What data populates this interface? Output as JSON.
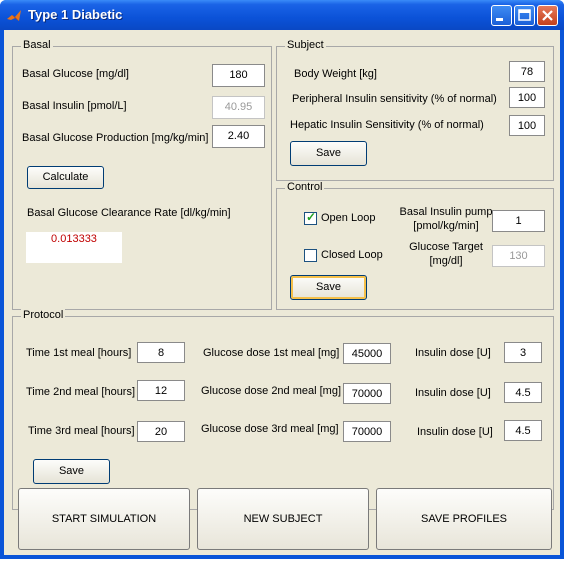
{
  "window": {
    "title": "Type 1 Diabetic"
  },
  "basal": {
    "title": "Basal",
    "glucose_label": "Basal Glucose [mg/dl]",
    "glucose_value": "180",
    "insulin_label": "Basal Insulin [pmol/L]",
    "insulin_value": "40.95",
    "production_label": "Basal Glucose Production [mg/kg/min]",
    "production_value": "2.40",
    "calculate_label": "Calculate",
    "clearance_label": "Basal Glucose Clearance Rate [dl/kg/min]",
    "clearance_value": "0.013333"
  },
  "subject": {
    "title": "Subject",
    "weight_label": "Body Weight [kg]",
    "weight_value": "78",
    "peripheral_label": "Peripheral Insulin sensitivity (% of normal)",
    "peripheral_value": "100",
    "hepatic_label": "Hepatic Insulin Sensitivity (% of normal)",
    "hepatic_value": "100",
    "save_label": "Save"
  },
  "control": {
    "title": "Control",
    "open_loop_label": "Open Loop",
    "open_loop_checked": true,
    "closed_loop_label": "Closed Loop",
    "closed_loop_checked": false,
    "pump_label": "Basal Insulin pump [pmol/kg/min]",
    "pump_value": "1",
    "target_label": "Glucose Target [mg/dl]",
    "target_value": "130",
    "save_label": "Save"
  },
  "protocol": {
    "title": "Protocol",
    "meal1_time_label": "Time 1st meal [hours]",
    "meal1_time_value": "8",
    "meal2_time_label": "Time 2nd meal [hours]",
    "meal2_time_value": "12",
    "meal3_time_label": "Time 3rd meal [hours]",
    "meal3_time_value": "20",
    "dose1_label": "Glucose dose 1st meal [mg]",
    "dose1_value": "45000",
    "dose2_label": "Glucose dose 2nd meal [mg]",
    "dose2_value": "70000",
    "dose3_label": "Glucose dose 3rd meal [mg]",
    "dose3_value": "70000",
    "insulin1_label": "Insulin dose [U]",
    "insulin1_value": "3",
    "insulin2_label": "Insulin  dose [U]",
    "insulin2_value": "4.5",
    "insulin3_label": "Insulin dose [U]",
    "insulin3_value": "4.5",
    "save_label": "Save"
  },
  "actions": {
    "start_label": "START SIMULATION",
    "new_subject_label": "NEW SUBJECT",
    "save_profiles_label": "SAVE PROFILES"
  }
}
